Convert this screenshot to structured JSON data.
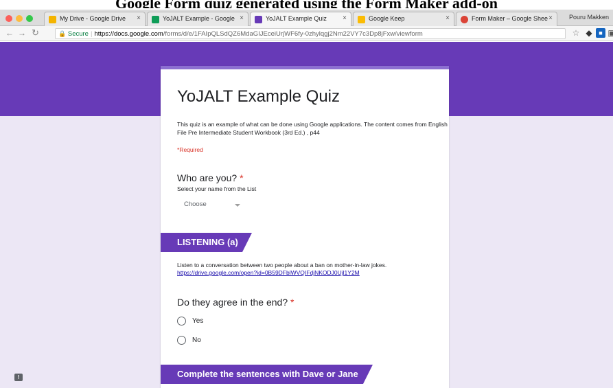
{
  "caption": "Google Form quiz generated using the Form Maker add-on",
  "browser": {
    "tabs": [
      {
        "label": "My Drive - Google Drive",
        "color": "#f4b400"
      },
      {
        "label": "YoJALT Example - Google",
        "color": "#0f9d58"
      },
      {
        "label": "YoJALT Example Quiz",
        "color": "#673ab7"
      },
      {
        "label": "Google Keep",
        "color": "#fbbc04"
      },
      {
        "label": "Form Maker – Google Shee",
        "color": "#db4437"
      }
    ],
    "profile": "Pouru Makken",
    "secure_label": "Secure",
    "url_host": "https://docs.google.com",
    "url_path": "/forms/d/e/1FAIpQLSdQZ6MdaGIJEceiUrjWF6fy-0zhylqgj2Nm22VY7c3Dp8jFxw/viewform"
  },
  "form": {
    "title": "YoJALT Example Quiz",
    "description": "This quiz is an example of what can be done using Google applications. The content comes from English File Pre Intermediate Student Workbook (3rd Ed.) , p44",
    "required_note": "*Required",
    "q1": {
      "label": "Who are you?",
      "required": "*",
      "hint": "Select your name from the List",
      "dropdown": "Choose"
    },
    "section1": "LISTENING (a)",
    "listening_text": "Listen to a conversation between two people about a ban on mother-in-law jokes.",
    "listening_link": "https://drive.google.com/open?id=0B59DFblWVQIFdjNKODJ0Ujl1Y2M",
    "q2": {
      "label": "Do they agree in the end?",
      "required": "*",
      "options": [
        "Yes",
        "No"
      ]
    },
    "section2": "Complete the sentences with Dave or Jane"
  },
  "colors": {
    "accent": "#673ab7",
    "background": "#ece7f5",
    "required": "#d93025"
  }
}
